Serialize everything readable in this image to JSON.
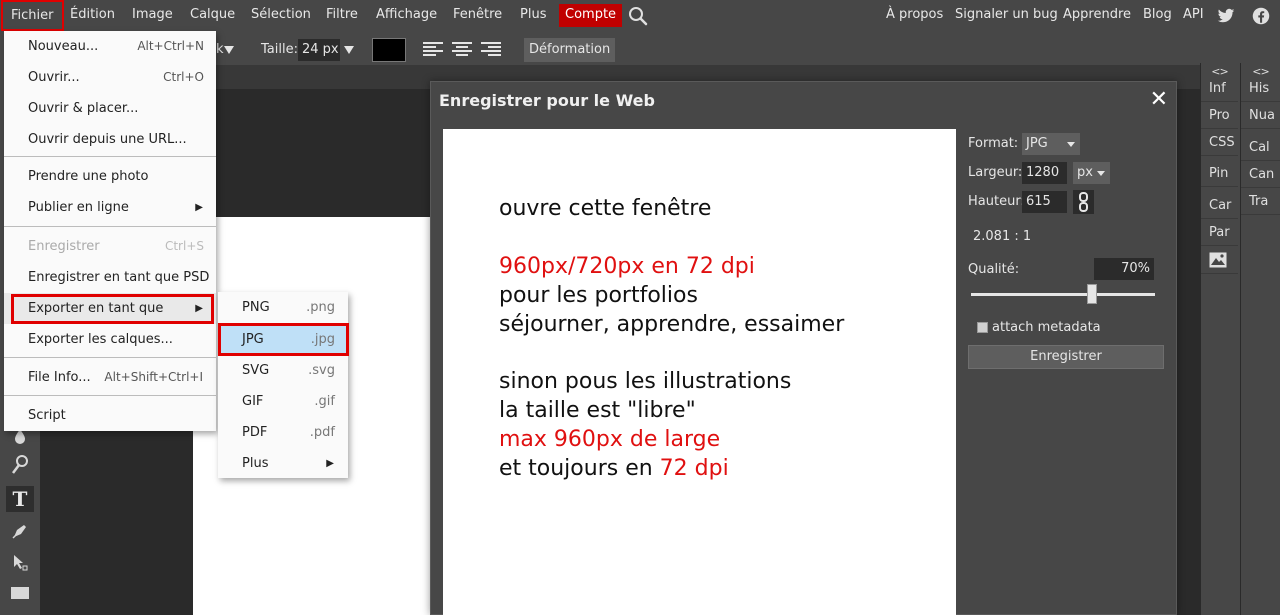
{
  "menubar": {
    "items": [
      "Fichier",
      "Édition",
      "Image",
      "Calque",
      "Sélection",
      "Filtre",
      "Affichage",
      "Fenêtre",
      "Plus"
    ],
    "account": "Compte",
    "right_links": [
      "À propos",
      "Signaler un bug",
      "Apprendre",
      "Blog",
      "API"
    ],
    "icons": [
      "search-icon",
      "twitter-icon",
      "facebook-icon"
    ]
  },
  "options_bar": {
    "size_label": "Taille:",
    "size_value": "24 px",
    "deform_label": "Déformation",
    "partial_char": "k"
  },
  "fichier_menu": {
    "items": [
      {
        "label": "Nouveau...",
        "shortcut": "Alt+Ctrl+N"
      },
      {
        "label": "Ouvrir...",
        "shortcut": "Ctrl+O"
      },
      {
        "label": "Ouvrir & placer...",
        "shortcut": ""
      },
      {
        "label": "Ouvrir depuis une URL...",
        "shortcut": ""
      },
      {
        "label": "Prendre une photo",
        "shortcut": ""
      },
      {
        "label": "Publier en ligne",
        "shortcut": ""
      },
      {
        "label": "Enregistrer",
        "shortcut": "Ctrl+S",
        "disabled": true
      },
      {
        "label": "Enregistrer en tant que PSD",
        "shortcut": ""
      },
      {
        "label": "Exporter en tant que",
        "shortcut": ""
      },
      {
        "label": "Exporter les calques...",
        "shortcut": ""
      },
      {
        "label": "File Info...",
        "shortcut": "Alt+Shift+Ctrl+I"
      },
      {
        "label": "Script",
        "shortcut": ""
      }
    ]
  },
  "export_submenu": {
    "items": [
      {
        "label": "PNG",
        "ext": ".png"
      },
      {
        "label": "JPG",
        "ext": ".jpg",
        "active": true
      },
      {
        "label": "SVG",
        "ext": ".svg"
      },
      {
        "label": "GIF",
        "ext": ".gif"
      },
      {
        "label": "PDF",
        "ext": ".pdf"
      },
      {
        "label": "Plus",
        "ext": ""
      }
    ]
  },
  "dialog": {
    "title": "Enregistrer pour le Web",
    "close": "✕",
    "format_label": "Format:",
    "format_value": "JPG",
    "width_label": "Largeur:",
    "width_value": "1280",
    "unit_value": "px",
    "height_label": "Hauteur:",
    "height_value": "615",
    "ratio": "2.081 : 1",
    "quality_label": "Qualité:",
    "quality_value": "70%",
    "quality_level": 0.7,
    "metadata_label": "attach metadata",
    "save_button": "Enregistrer"
  },
  "preview_text": {
    "line1": "ouvre cette fenêtre",
    "line2": "960px/720px en 72 dpi",
    "line3": "pour les portfolios",
    "line4": "séjourner, apprendre, essaimer",
    "line5": "sinon pous les illustrations",
    "line6": "la taille est \"libre\"",
    "line7": "max 960px de large",
    "line8_prefix": "et toujours en ",
    "line8_red": "72 dpi"
  },
  "right_panel_1": {
    "toggle": "<>",
    "items": [
      "Inf",
      "Pro",
      "CSS",
      "Pin",
      "Car",
      "Par"
    ]
  },
  "right_panel_2": {
    "toggle": "<>",
    "items": [
      "His",
      "Nua",
      "Cal",
      "Can",
      "Tra"
    ]
  },
  "colors": {
    "accent_red": "#c00000",
    "highlight_frame": "#e00000",
    "menu_active": "#bfe0f7",
    "preview_red": "#e01010"
  }
}
